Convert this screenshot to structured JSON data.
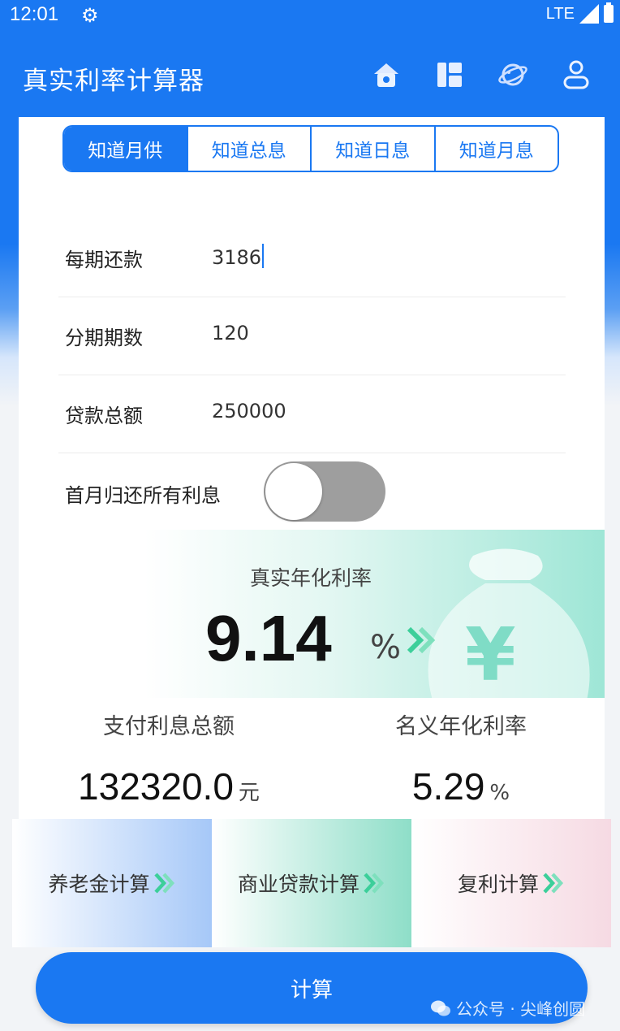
{
  "status_bar": {
    "time": "12:01",
    "network": "LTE"
  },
  "app": {
    "title": "真实利率计算器"
  },
  "tabs": [
    {
      "label": "知道月供",
      "active": true
    },
    {
      "label": "知道总息",
      "active": false
    },
    {
      "label": "知道日息",
      "active": false
    },
    {
      "label": "知道月息",
      "active": false
    }
  ],
  "form": {
    "payment": {
      "label": "每期还款",
      "value": "3186"
    },
    "periods": {
      "label": "分期期数",
      "value": "120"
    },
    "principal": {
      "label": "贷款总额",
      "value": "250000"
    },
    "first_month_toggle": {
      "label": "首月归还所有利息",
      "on": false
    }
  },
  "result": {
    "title": "真实年化利率",
    "value": "9.14",
    "unit": "%"
  },
  "stats": {
    "total_interest": {
      "label": "支付利息总额",
      "value": "132320.0",
      "unit": "元"
    },
    "nominal_rate": {
      "label": "名义年化利率",
      "value": "5.29",
      "unit": "%"
    }
  },
  "promos": [
    {
      "label": "养老金计算"
    },
    {
      "label": "商业贷款计算"
    },
    {
      "label": "复利计算"
    }
  ],
  "calc_button": {
    "label": "计算"
  },
  "watermark": {
    "text": "公众号 · 尖峰创圆"
  },
  "colors": {
    "primary": "#1a78f2",
    "accent_green": "#3ccf9a",
    "toggle_off": "#9e9e9e"
  }
}
